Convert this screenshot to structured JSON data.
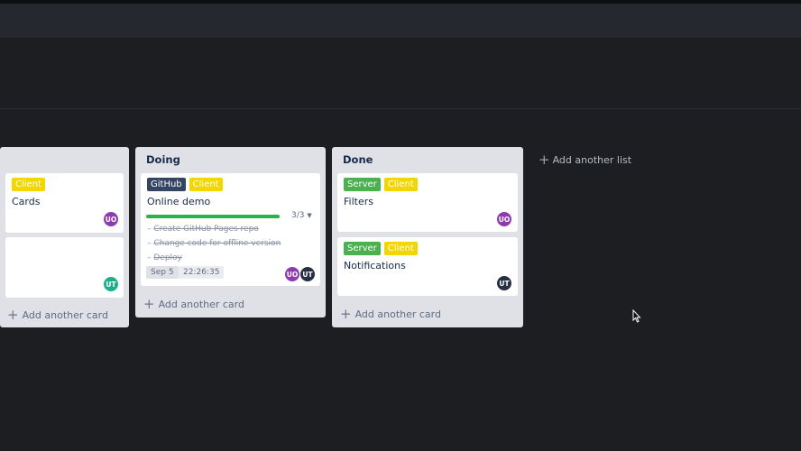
{
  "lists": [
    {
      "title": "",
      "cards": [
        {
          "labels": [
            "Client"
          ],
          "title": "Cards",
          "avatars": [
            "UO"
          ]
        },
        {
          "labels": [],
          "title": "",
          "avatars": [
            "UT"
          ]
        }
      ],
      "add_card": "Add another card"
    },
    {
      "title": "Doing",
      "cards": [
        {
          "labels": [
            "GitHub",
            "Client"
          ],
          "title": "Online demo",
          "progress_text": "3/3",
          "progress": 1.0,
          "checklist": [
            "Create GitHub Pages repo",
            "Change code for offline version",
            "Deploy"
          ],
          "due": "Sep 5",
          "time": "22:26:35",
          "avatars": [
            "UO",
            "UT"
          ]
        }
      ],
      "add_card": "Add another card"
    },
    {
      "title": "Done",
      "cards": [
        {
          "labels": [
            "Server",
            "Client"
          ],
          "title": "Filters",
          "avatars": [
            "UO"
          ]
        },
        {
          "labels": [
            "Server",
            "Client"
          ],
          "title": "Notifications",
          "avatars": [
            "UT"
          ]
        }
      ],
      "add_card": "Add another card"
    }
  ],
  "add_list": "Add another list",
  "colors": {
    "uo": "#8e3bb0",
    "ut_teal": "#1fae8a",
    "ut_dark": "#263040",
    "server": "#4caf50",
    "client": "#f2d600",
    "github": "#344563"
  }
}
